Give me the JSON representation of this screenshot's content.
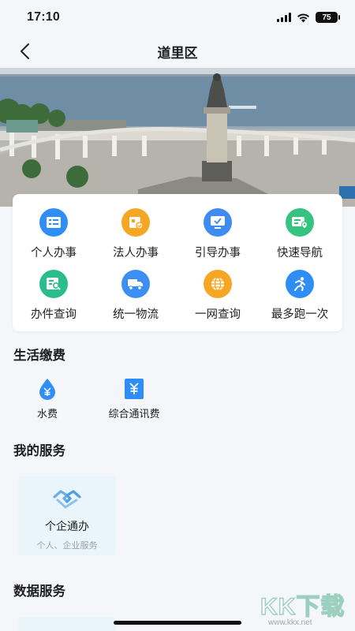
{
  "status_bar": {
    "time": "17:10",
    "battery": "75"
  },
  "nav": {
    "title": "道里区"
  },
  "services": [
    {
      "label": "个人办事",
      "icon": "person-card-icon",
      "color": "#2e8ef5"
    },
    {
      "label": "法人办事",
      "icon": "enterprise-icon",
      "color": "#f5a623"
    },
    {
      "label": "引导办事",
      "icon": "monitor-icon",
      "color": "#3f8cf0"
    },
    {
      "label": "快速导航",
      "icon": "navigation-icon",
      "color": "#36c27f"
    },
    {
      "label": "办件查询",
      "icon": "document-search-icon",
      "color": "#2bbd8a"
    },
    {
      "label": "统一物流",
      "icon": "truck-icon",
      "color": "#3d8ef2"
    },
    {
      "label": "一网查询",
      "icon": "globe-icon",
      "color": "#f5a623"
    },
    {
      "label": "最多跑一次",
      "icon": "running-icon",
      "color": "#2e8ef5"
    }
  ],
  "life_payment": {
    "title": "生活缴费",
    "items": [
      {
        "label": "水费",
        "icon": "water-drop-yen-icon"
      },
      {
        "label": "综合通讯费",
        "icon": "bill-yen-icon"
      }
    ]
  },
  "my_services": {
    "title": "我的服务",
    "card": {
      "title": "个企通办",
      "subtitle": "个人、企业服务",
      "icon": "handshake-icon"
    }
  },
  "data_services": {
    "title": "数据服务"
  },
  "watermark": {
    "text": "KK下载",
    "url": "www.kkx.net"
  }
}
